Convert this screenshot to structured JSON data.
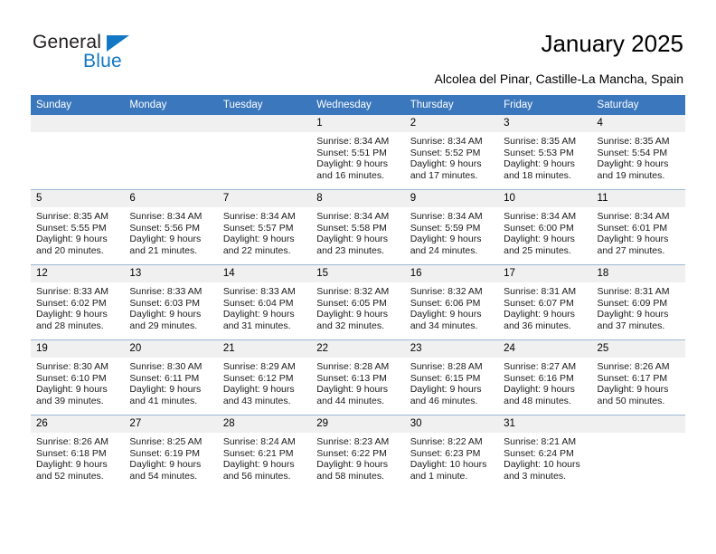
{
  "brand": {
    "name_top": "General",
    "name_bottom": "Blue"
  },
  "header": {
    "title": "January 2025",
    "subtitle": "Alcolea del Pinar, Castille-La Mancha, Spain"
  },
  "theme": {
    "header_blue": "#3b77bc",
    "logo_blue": "#1277c4",
    "daynum_bg": "#f0f0f0",
    "separator": "#9bb7d4"
  },
  "calendar": {
    "weekday_headers": [
      "Sunday",
      "Monday",
      "Tuesday",
      "Wednesday",
      "Thursday",
      "Friday",
      "Saturday"
    ],
    "weeks": [
      [
        {
          "day": "",
          "empty": true,
          "sunrise": "",
          "sunset": "",
          "daylight1": "",
          "daylight2": ""
        },
        {
          "day": "",
          "empty": true,
          "sunrise": "",
          "sunset": "",
          "daylight1": "",
          "daylight2": ""
        },
        {
          "day": "",
          "empty": true,
          "sunrise": "",
          "sunset": "",
          "daylight1": "",
          "daylight2": ""
        },
        {
          "day": "1",
          "sunrise": "Sunrise: 8:34 AM",
          "sunset": "Sunset: 5:51 PM",
          "daylight1": "Daylight: 9 hours",
          "daylight2": "and 16 minutes."
        },
        {
          "day": "2",
          "sunrise": "Sunrise: 8:34 AM",
          "sunset": "Sunset: 5:52 PM",
          "daylight1": "Daylight: 9 hours",
          "daylight2": "and 17 minutes."
        },
        {
          "day": "3",
          "sunrise": "Sunrise: 8:35 AM",
          "sunset": "Sunset: 5:53 PM",
          "daylight1": "Daylight: 9 hours",
          "daylight2": "and 18 minutes."
        },
        {
          "day": "4",
          "sunrise": "Sunrise: 8:35 AM",
          "sunset": "Sunset: 5:54 PM",
          "daylight1": "Daylight: 9 hours",
          "daylight2": "and 19 minutes."
        }
      ],
      [
        {
          "day": "5",
          "sunrise": "Sunrise: 8:35 AM",
          "sunset": "Sunset: 5:55 PM",
          "daylight1": "Daylight: 9 hours",
          "daylight2": "and 20 minutes."
        },
        {
          "day": "6",
          "sunrise": "Sunrise: 8:34 AM",
          "sunset": "Sunset: 5:56 PM",
          "daylight1": "Daylight: 9 hours",
          "daylight2": "and 21 minutes."
        },
        {
          "day": "7",
          "sunrise": "Sunrise: 8:34 AM",
          "sunset": "Sunset: 5:57 PM",
          "daylight1": "Daylight: 9 hours",
          "daylight2": "and 22 minutes."
        },
        {
          "day": "8",
          "sunrise": "Sunrise: 8:34 AM",
          "sunset": "Sunset: 5:58 PM",
          "daylight1": "Daylight: 9 hours",
          "daylight2": "and 23 minutes."
        },
        {
          "day": "9",
          "sunrise": "Sunrise: 8:34 AM",
          "sunset": "Sunset: 5:59 PM",
          "daylight1": "Daylight: 9 hours",
          "daylight2": "and 24 minutes."
        },
        {
          "day": "10",
          "sunrise": "Sunrise: 8:34 AM",
          "sunset": "Sunset: 6:00 PM",
          "daylight1": "Daylight: 9 hours",
          "daylight2": "and 25 minutes."
        },
        {
          "day": "11",
          "sunrise": "Sunrise: 8:34 AM",
          "sunset": "Sunset: 6:01 PM",
          "daylight1": "Daylight: 9 hours",
          "daylight2": "and 27 minutes."
        }
      ],
      [
        {
          "day": "12",
          "sunrise": "Sunrise: 8:33 AM",
          "sunset": "Sunset: 6:02 PM",
          "daylight1": "Daylight: 9 hours",
          "daylight2": "and 28 minutes."
        },
        {
          "day": "13",
          "sunrise": "Sunrise: 8:33 AM",
          "sunset": "Sunset: 6:03 PM",
          "daylight1": "Daylight: 9 hours",
          "daylight2": "and 29 minutes."
        },
        {
          "day": "14",
          "sunrise": "Sunrise: 8:33 AM",
          "sunset": "Sunset: 6:04 PM",
          "daylight1": "Daylight: 9 hours",
          "daylight2": "and 31 minutes."
        },
        {
          "day": "15",
          "sunrise": "Sunrise: 8:32 AM",
          "sunset": "Sunset: 6:05 PM",
          "daylight1": "Daylight: 9 hours",
          "daylight2": "and 32 minutes."
        },
        {
          "day": "16",
          "sunrise": "Sunrise: 8:32 AM",
          "sunset": "Sunset: 6:06 PM",
          "daylight1": "Daylight: 9 hours",
          "daylight2": "and 34 minutes."
        },
        {
          "day": "17",
          "sunrise": "Sunrise: 8:31 AM",
          "sunset": "Sunset: 6:07 PM",
          "daylight1": "Daylight: 9 hours",
          "daylight2": "and 36 minutes."
        },
        {
          "day": "18",
          "sunrise": "Sunrise: 8:31 AM",
          "sunset": "Sunset: 6:09 PM",
          "daylight1": "Daylight: 9 hours",
          "daylight2": "and 37 minutes."
        }
      ],
      [
        {
          "day": "19",
          "sunrise": "Sunrise: 8:30 AM",
          "sunset": "Sunset: 6:10 PM",
          "daylight1": "Daylight: 9 hours",
          "daylight2": "and 39 minutes."
        },
        {
          "day": "20",
          "sunrise": "Sunrise: 8:30 AM",
          "sunset": "Sunset: 6:11 PM",
          "daylight1": "Daylight: 9 hours",
          "daylight2": "and 41 minutes."
        },
        {
          "day": "21",
          "sunrise": "Sunrise: 8:29 AM",
          "sunset": "Sunset: 6:12 PM",
          "daylight1": "Daylight: 9 hours",
          "daylight2": "and 43 minutes."
        },
        {
          "day": "22",
          "sunrise": "Sunrise: 8:28 AM",
          "sunset": "Sunset: 6:13 PM",
          "daylight1": "Daylight: 9 hours",
          "daylight2": "and 44 minutes."
        },
        {
          "day": "23",
          "sunrise": "Sunrise: 8:28 AM",
          "sunset": "Sunset: 6:15 PM",
          "daylight1": "Daylight: 9 hours",
          "daylight2": "and 46 minutes."
        },
        {
          "day": "24",
          "sunrise": "Sunrise: 8:27 AM",
          "sunset": "Sunset: 6:16 PM",
          "daylight1": "Daylight: 9 hours",
          "daylight2": "and 48 minutes."
        },
        {
          "day": "25",
          "sunrise": "Sunrise: 8:26 AM",
          "sunset": "Sunset: 6:17 PM",
          "daylight1": "Daylight: 9 hours",
          "daylight2": "and 50 minutes."
        }
      ],
      [
        {
          "day": "26",
          "sunrise": "Sunrise: 8:26 AM",
          "sunset": "Sunset: 6:18 PM",
          "daylight1": "Daylight: 9 hours",
          "daylight2": "and 52 minutes."
        },
        {
          "day": "27",
          "sunrise": "Sunrise: 8:25 AM",
          "sunset": "Sunset: 6:19 PM",
          "daylight1": "Daylight: 9 hours",
          "daylight2": "and 54 minutes."
        },
        {
          "day": "28",
          "sunrise": "Sunrise: 8:24 AM",
          "sunset": "Sunset: 6:21 PM",
          "daylight1": "Daylight: 9 hours",
          "daylight2": "and 56 minutes."
        },
        {
          "day": "29",
          "sunrise": "Sunrise: 8:23 AM",
          "sunset": "Sunset: 6:22 PM",
          "daylight1": "Daylight: 9 hours",
          "daylight2": "and 58 minutes."
        },
        {
          "day": "30",
          "sunrise": "Sunrise: 8:22 AM",
          "sunset": "Sunset: 6:23 PM",
          "daylight1": "Daylight: 10 hours",
          "daylight2": "and 1 minute."
        },
        {
          "day": "31",
          "sunrise": "Sunrise: 8:21 AM",
          "sunset": "Sunset: 6:24 PM",
          "daylight1": "Daylight: 10 hours",
          "daylight2": "and 3 minutes."
        },
        {
          "day": "",
          "empty": true,
          "sunrise": "",
          "sunset": "",
          "daylight1": "",
          "daylight2": ""
        }
      ]
    ]
  }
}
